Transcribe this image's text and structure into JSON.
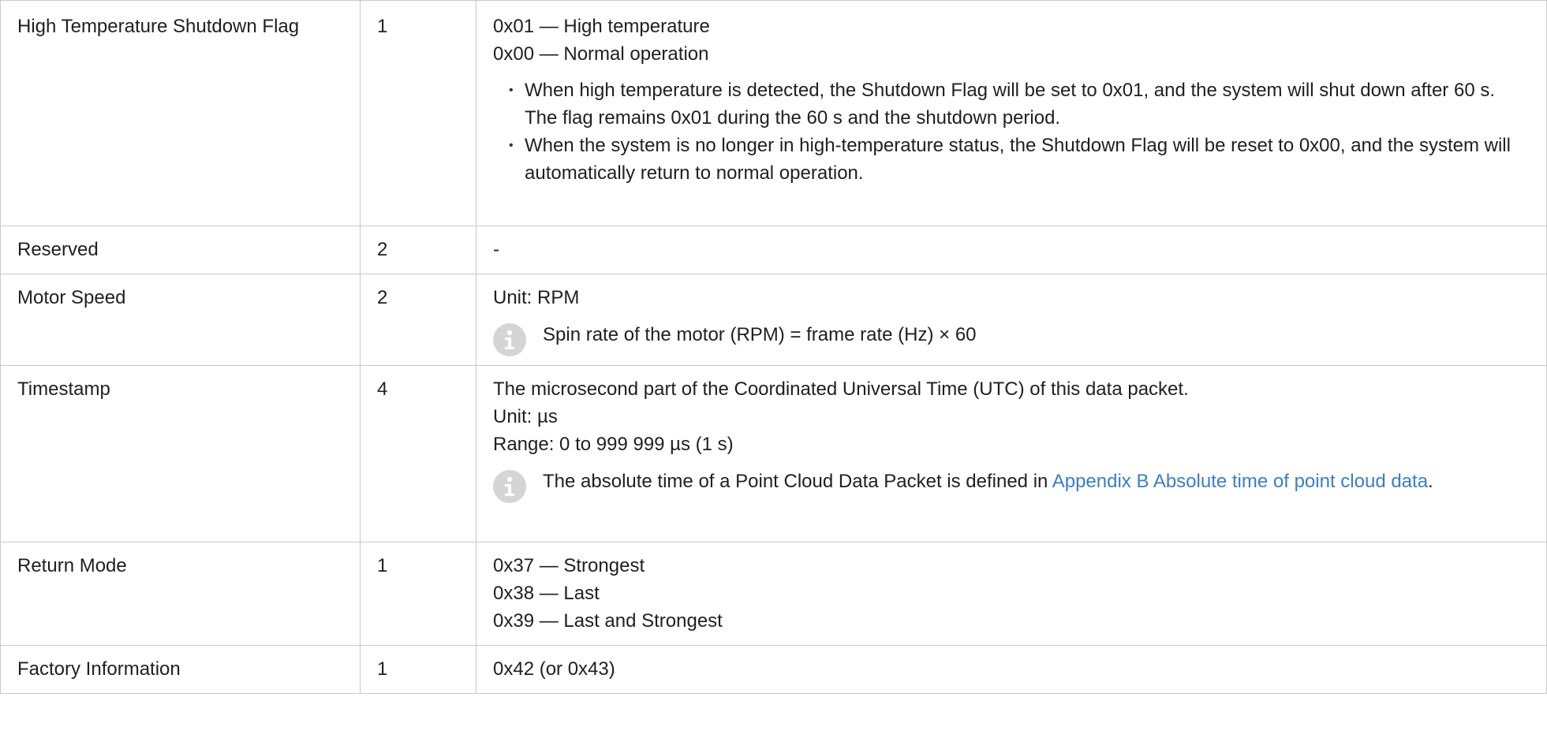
{
  "rows": [
    {
      "field": "High Temperature Shutdown Flag",
      "bytes": "1",
      "lines": [
        "0x01 — High temperature",
        "0x00 — Normal operation"
      ],
      "bullets": [
        "When high temperature is detected, the Shutdown Flag will be set to 0x01, and the system will shut down after 60 s. The flag remains 0x01 during the 60 s and the shutdown period.",
        "When the system is no longer in high-temperature status, the Shutdown Flag will be reset to 0x00, and the system will automatically return to normal operation."
      ]
    },
    {
      "field": "Reserved",
      "bytes": "2",
      "lines": [
        "-"
      ]
    },
    {
      "field": "Motor Speed",
      "bytes": "2",
      "lines": [
        "Unit: RPM"
      ],
      "note": "Spin rate of the motor (RPM) = frame rate (Hz) × 60"
    },
    {
      "field": "Timestamp",
      "bytes": "4",
      "lines": [
        "The microsecond part of the Coordinated Universal Time (UTC) of this data packet.",
        "Unit: µs",
        "Range: 0 to 999 999 µs (1 s)"
      ],
      "note_prefix": "The absolute time of a Point Cloud Data Packet is defined in ",
      "note_link": "Appendix B Absolute time of point cloud data",
      "note_suffix": "."
    },
    {
      "field": "Return Mode",
      "bytes": "1",
      "lines": [
        "0x37 — Strongest",
        "0x38 — Last",
        "0x39 — Last and Strongest"
      ]
    },
    {
      "field": "Factory Information",
      "bytes": "1",
      "lines": [
        "0x42 (or 0x43)"
      ]
    }
  ],
  "icons": {
    "note": "info-icon"
  },
  "colors": {
    "link": "#3c7dc4",
    "border": "#c9c9c9",
    "icon_bg": "#d5d5d5"
  }
}
